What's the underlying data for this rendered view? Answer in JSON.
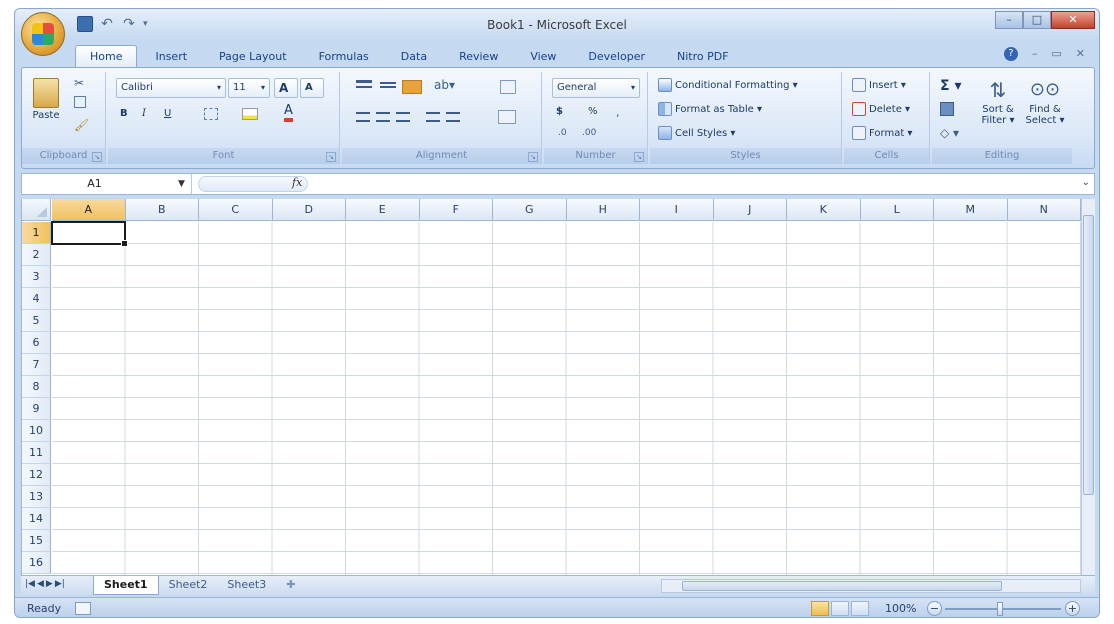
{
  "window": {
    "title": "Book1 - Microsoft Excel"
  },
  "quick_access": {
    "save_icon": "save-icon",
    "undo_icon": "undo-icon",
    "redo_icon": "redo-icon"
  },
  "tabs": [
    "Home",
    "Insert",
    "Page Layout",
    "Formulas",
    "Data",
    "Review",
    "View",
    "Developer",
    "Nitro PDF"
  ],
  "active_tab": "Home",
  "ribbon": {
    "clipboard": {
      "paste": "Paste",
      "group": "Clipboard"
    },
    "font": {
      "name": "Calibri",
      "size": "11",
      "bold": "B",
      "italic": "I",
      "underline": "U",
      "grow": "A",
      "shrink": "A",
      "group": "Font"
    },
    "alignment": {
      "group": "Alignment"
    },
    "number": {
      "format": "General",
      "currency": "$",
      "percent": "%",
      "group": "Number"
    },
    "styles": {
      "conditional": "Conditional Formatting",
      "format_table": "Format as Table",
      "cell_styles": "Cell Styles",
      "group": "Styles"
    },
    "cells": {
      "insert": "Insert",
      "delete": "Delete",
      "format": "Format",
      "group": "Cells"
    },
    "editing": {
      "sort": "Sort &",
      "sort2": "Filter",
      "find": "Find &",
      "find2": "Select",
      "group": "Editing"
    }
  },
  "formula_bar": {
    "name_box": "A1",
    "fx": "fx",
    "value": ""
  },
  "grid": {
    "columns": [
      "A",
      "B",
      "C",
      "D",
      "E",
      "F",
      "G",
      "H",
      "I",
      "J",
      "K",
      "L",
      "M",
      "N"
    ],
    "rows": [
      "1",
      "2",
      "3",
      "4",
      "5",
      "6",
      "7",
      "8",
      "9",
      "10",
      "11",
      "12",
      "13",
      "14",
      "15",
      "16"
    ],
    "selected_cell": "A1"
  },
  "sheets": [
    "Sheet1",
    "Sheet2",
    "Sheet3"
  ],
  "active_sheet": "Sheet1",
  "status": {
    "ready": "Ready",
    "zoom": "100%"
  },
  "colors": {
    "ribbon_bg": "#dae7f7",
    "accent": "#15428b",
    "selection": "#f1c15f"
  }
}
